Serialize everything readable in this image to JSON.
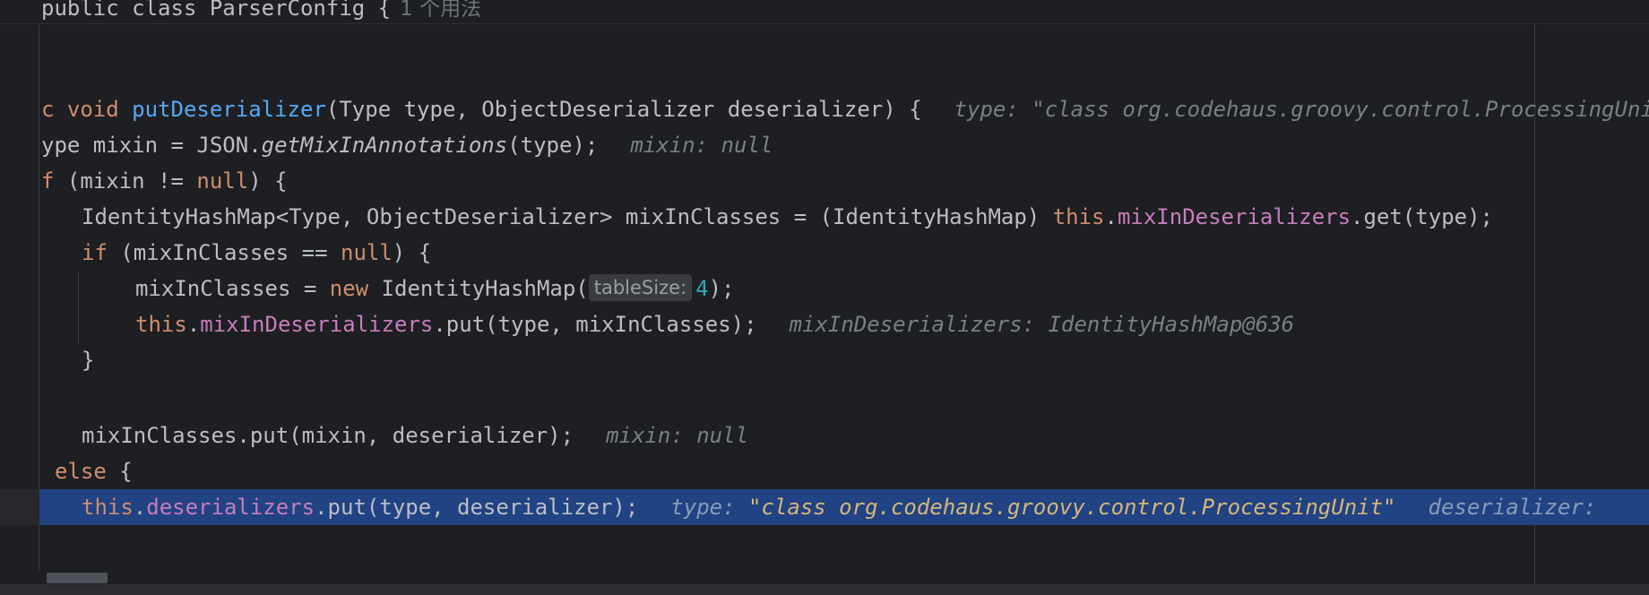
{
  "sticky_header": {
    "code": "public class ParserConfig {",
    "usages": "1 个用法"
  },
  "lines": {
    "l1": {
      "p1": "c void ",
      "p2": "putDeserializer",
      "p3": "(Type type, ObjectDeserializer deserializer) {",
      "hint": "type: \"class org.codehaus.groovy.control.ProcessingUnit\""
    },
    "l2": {
      "p1": "ype mixin = JSON.",
      "p2": "getMixInAnnotations",
      "p3": "(type);",
      "hint": "mixin: null"
    },
    "l3": {
      "p1": "f",
      "p2": " (mixin != ",
      "p3": "null",
      "p4": ") {"
    },
    "l4": {
      "p1": "IdentityHashMap<Type, ObjectDeserializer> mixInClasses = (IdentityHashMap) ",
      "p2": "this",
      "p3": ".",
      "p4": "mixInDeserializers",
      "p5": ".get(type);"
    },
    "l5": {
      "p1": "if",
      "p2": " (mixInClasses == ",
      "p3": "null",
      "p4": ") {"
    },
    "l6": {
      "p1": "mixInClasses = ",
      "p2": "new",
      "p3": " IdentityHashMap(",
      "param_label": "tableSize:",
      "p4": "4",
      "p5": ");"
    },
    "l7": {
      "p1": "this",
      "p2": ".",
      "p3": "mixInDeserializers",
      "p4": ".put(type, mixInClasses);",
      "hint": "mixInDeserializers: IdentityHashMap@636"
    },
    "l8": {
      "p1": "}"
    },
    "l9": {
      "p1": "mixInClasses.put(mixin, deserializer);",
      "hint": "mixin: null"
    },
    "l10": {
      "p1": "else",
      "p2": " {"
    },
    "l11": {
      "p1": "this",
      "p2": ".",
      "p3": "deserializers",
      "p4": ".put(type, deserializer);",
      "hint_label": "type:",
      "hint_value": "\"class org.codehaus.groovy.control.ProcessingUnit\"",
      "hint2": "deserializer: "
    }
  },
  "colors": {
    "background": "#1e1f22",
    "keyword": "#cf8e6d",
    "method": "#56a8f5",
    "field": "#c77dbb",
    "number": "#2aacb8",
    "current_line": "#214283"
  }
}
